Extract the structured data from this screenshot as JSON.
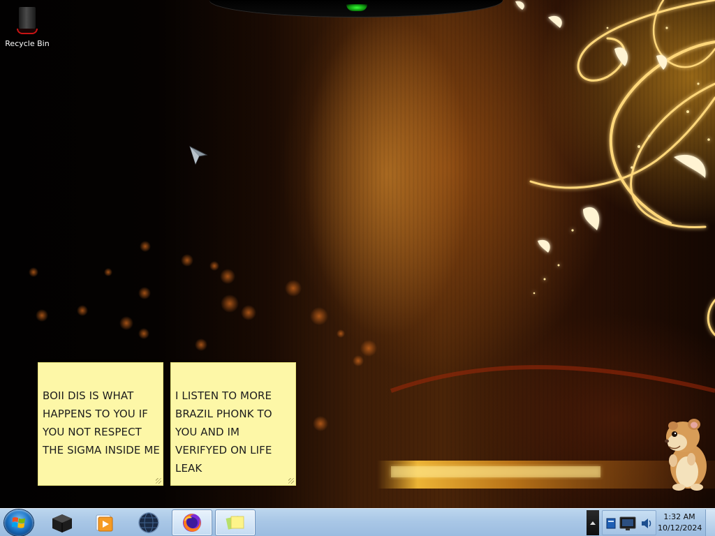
{
  "desktop": {
    "icons": [
      {
        "label": "Recycle Bin",
        "icon": "recycle-bin-icon"
      }
    ]
  },
  "sticky_notes": [
    {
      "text": "BOII DIS IS WHAT HAPPENS TO YOU IF YOU NOT RESPECT THE SIGMA INSIDE ME"
    },
    {
      "text": "I LISTEN TO MORE BRAZIL PHONK TO YOU AND IM VERIFYED ON LIFE LEAK"
    }
  ],
  "taskbar": {
    "start_icon": "windows-logo-icon",
    "pinned": [
      {
        "icon": "black-box-app-icon",
        "active": false
      },
      {
        "icon": "media-player-icon",
        "active": false
      },
      {
        "icon": "dark-globe-icon",
        "active": false
      },
      {
        "icon": "firefox-icon",
        "active": true
      },
      {
        "icon": "sticky-notes-icon",
        "active": true
      }
    ],
    "tray_icons": [
      "action-center-icon",
      "network-icon",
      "volume-icon"
    ],
    "clock": {
      "time": "1:32 AM",
      "date": "10/12/2024"
    }
  },
  "colors": {
    "taskbar": "#a9c7e6",
    "sticky_note": "#fdf7a7",
    "wallpaper_glow": "#ffb428"
  }
}
